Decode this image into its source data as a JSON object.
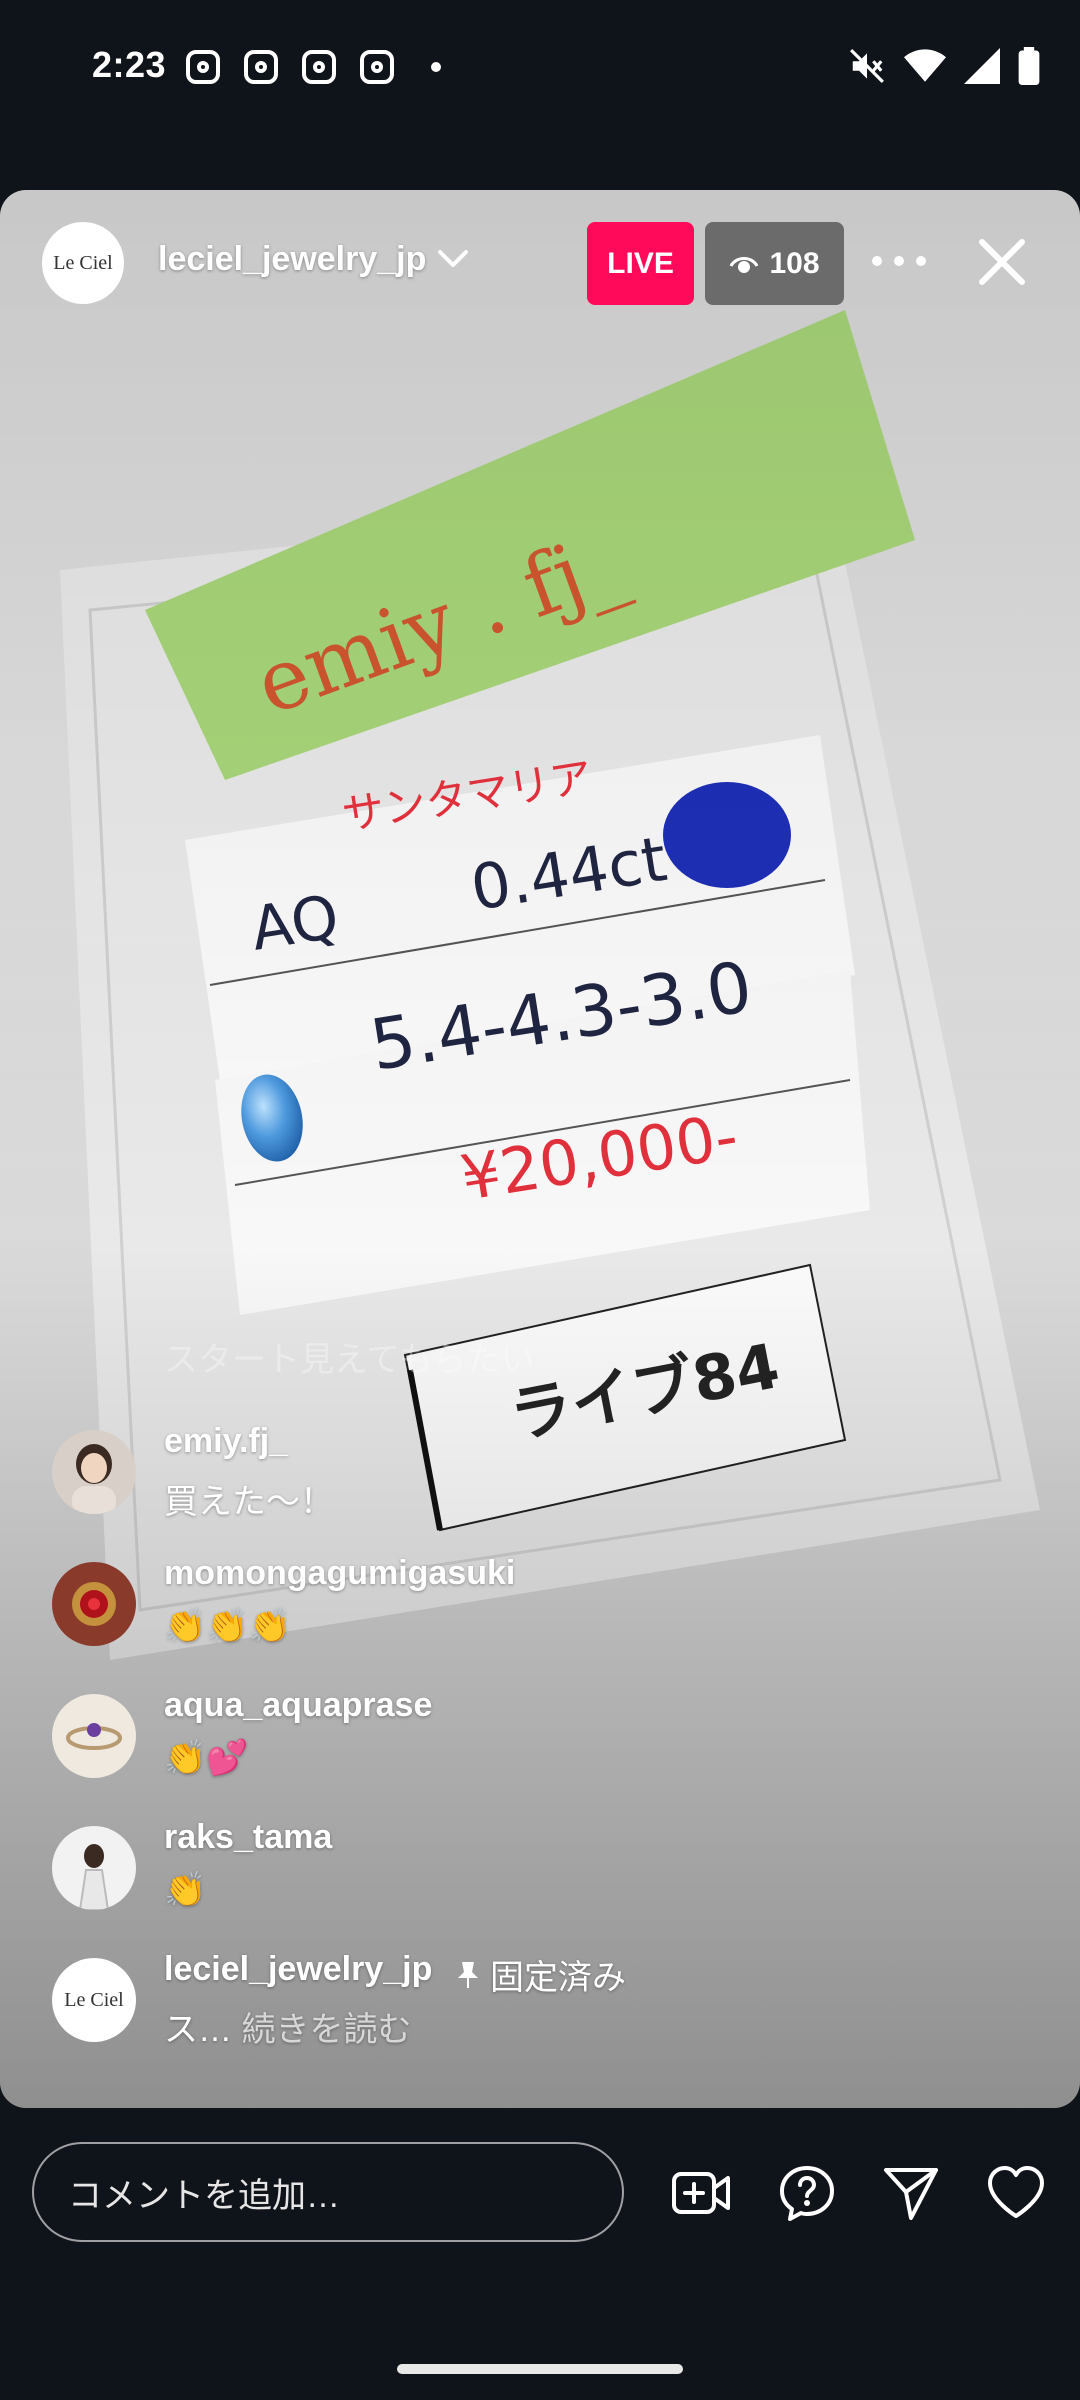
{
  "status_bar": {
    "time": "2:23",
    "notification_icons": [
      "instagram-icon",
      "instagram-icon",
      "instagram-icon",
      "instagram-icon"
    ],
    "right_icons": [
      "mute-icon",
      "wifi-icon",
      "signal-icon",
      "battery-icon"
    ]
  },
  "live": {
    "host_name": "leciel_jewelry_jp",
    "host_avatar_text": "Le Ciel",
    "live_label": "LIVE",
    "viewer_count": "108",
    "video_text": {
      "sticky_note": "emiy . fj_",
      "red_note": "サンタマリア",
      "stone": "AQ",
      "carat": "0.44ct",
      "dimensions": "5.4-4.3-3.0",
      "price": "¥20,000-",
      "live_tag": "ライブ84"
    }
  },
  "comments": {
    "faded": "スタート見えてもらたい",
    "items": [
      {
        "username": "emiy.fj_",
        "text": "買えた〜！"
      },
      {
        "username": "momongagumigasuki",
        "text": "👏👏👏"
      },
      {
        "username": "aqua_aquaprase",
        "text": "👏💕"
      },
      {
        "username": "raks_tama",
        "text": "👏"
      }
    ],
    "pinned": {
      "username": "leciel_jewelry_jp",
      "pinned_label": "固定済み",
      "text": "ス…",
      "read_more": "続きを読む"
    }
  },
  "bottom_bar": {
    "comment_placeholder": "コメントを追加…",
    "icons": [
      "add-video-icon",
      "question-icon",
      "send-icon",
      "heart-icon"
    ]
  },
  "colors": {
    "live_badge": "#ff0a5a",
    "background": "#0f131a"
  }
}
